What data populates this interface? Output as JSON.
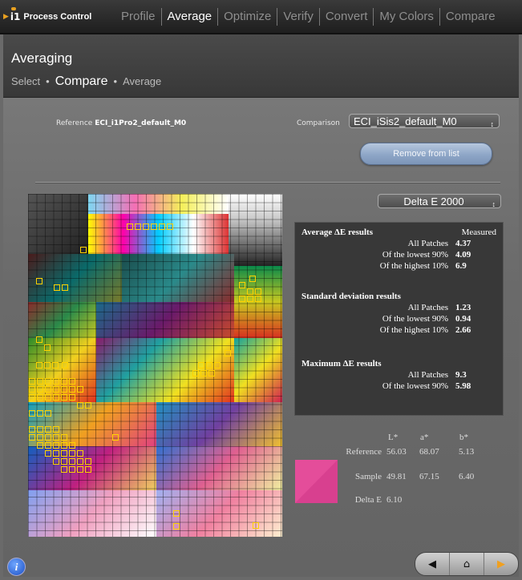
{
  "app": {
    "logo_text": "Process Control"
  },
  "nav": {
    "tabs": [
      {
        "label": "Profile",
        "active": false
      },
      {
        "label": "Average",
        "active": true
      },
      {
        "label": "Optimize",
        "active": false
      },
      {
        "label": "Verify",
        "active": false
      },
      {
        "label": "Convert",
        "active": false
      },
      {
        "label": "My Colors",
        "active": false
      },
      {
        "label": "Compare",
        "active": false
      }
    ]
  },
  "header": {
    "title": "Averaging",
    "breadcrumb": [
      "Select",
      "Compare",
      "Average"
    ],
    "breadcrumb_current": "Compare"
  },
  "reference": {
    "label": "Reference",
    "value": "ECI_i1Pro2_default_M0"
  },
  "comparison": {
    "label": "Comparison",
    "selected": "ECI_iSis2_default_M0"
  },
  "remove_button": "Remove from list",
  "metric_select": "Delta E 2000",
  "results": {
    "column_header": "Measured",
    "average": {
      "title": "Average ΔE results",
      "rows": [
        {
          "label": "All Patches",
          "value": "4.37"
        },
        {
          "label": "Of the lowest 90%",
          "value": "4.09"
        },
        {
          "label": "Of the highest 10%",
          "value": "6.9"
        }
      ]
    },
    "stddev": {
      "title": "Standard deviation results",
      "rows": [
        {
          "label": "All Patches",
          "value": "1.23"
        },
        {
          "label": "Of the lowest 90%",
          "value": "0.94"
        },
        {
          "label": "Of the highest 10%",
          "value": "2.66"
        }
      ]
    },
    "maximum": {
      "title": "Maximum ΔE results",
      "rows": [
        {
          "label": "All Patches",
          "value": "9.3"
        },
        {
          "label": "Of the lowest 90%",
          "value": "5.98"
        }
      ]
    }
  },
  "lab": {
    "headers": [
      "L*",
      "a*",
      "b*"
    ],
    "reference": {
      "label": "Reference",
      "L": "56.03",
      "a": "68.07",
      "b": "5.13"
    },
    "sample": {
      "label": "Sample",
      "L": "49.81",
      "a": "67.15",
      "b": "6.40"
    },
    "delta": {
      "label": "Delta E",
      "value": "6.10"
    },
    "swatch_color": "#d8408f"
  },
  "footer": {
    "info_icon": "info-icon",
    "nav_icons": [
      "back-arrow-icon",
      "home-icon",
      "forward-arrow-icon"
    ]
  },
  "colors": {
    "accent": "#e8a020",
    "highlight_outline": "#ffd200",
    "button_blue": "#8ea6c7"
  }
}
